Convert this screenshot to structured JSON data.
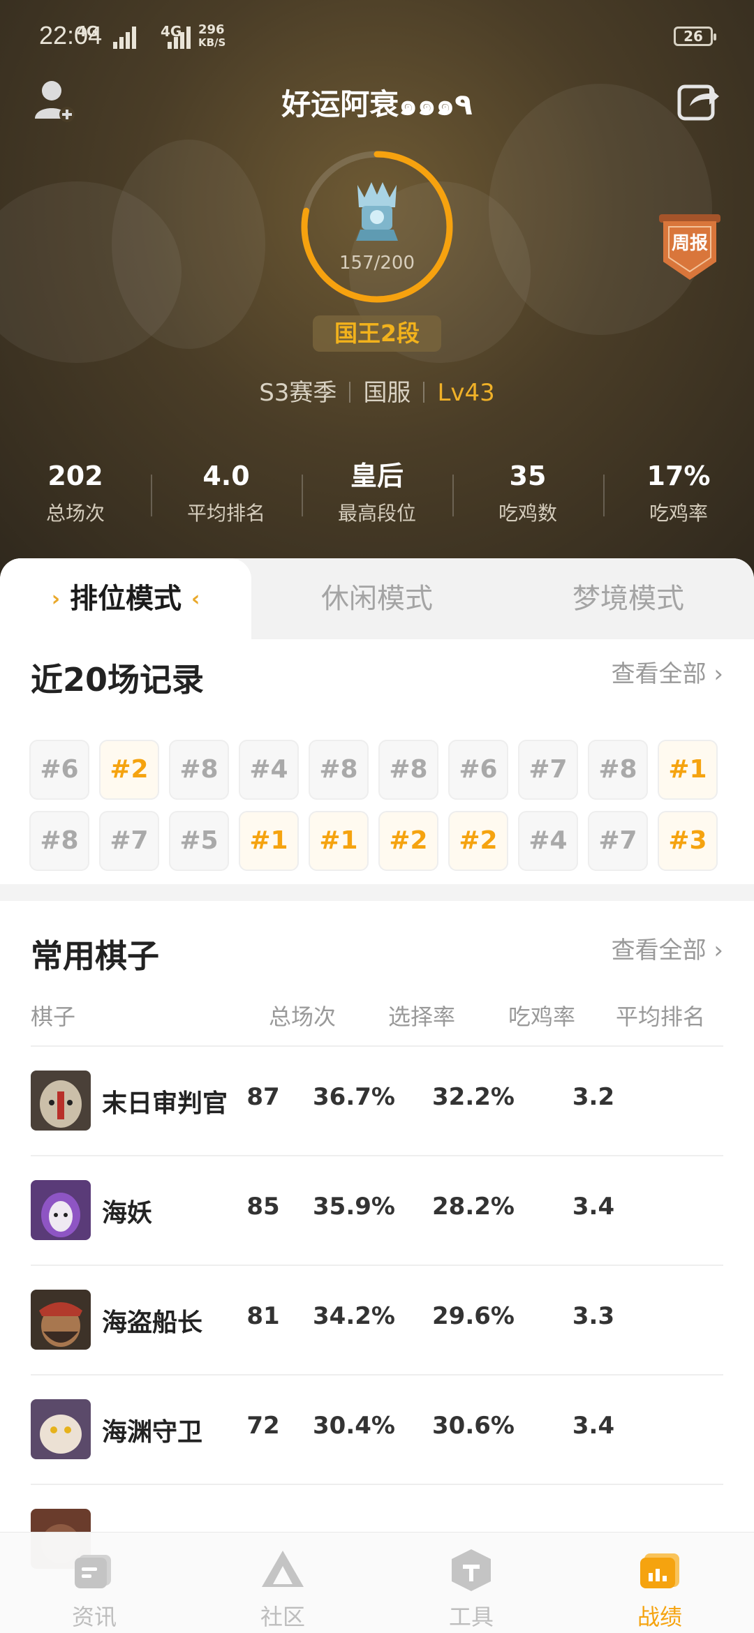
{
  "status_bar": {
    "time": "22:04",
    "network_1": "4G",
    "network_2": "4G",
    "speed_value": "296",
    "speed_unit": "KB/S",
    "battery": "26"
  },
  "profile": {
    "username": "好运阿衰๑๑๑٩",
    "rank_progress": "157/200",
    "rank_progress_fraction": 0.785,
    "rank_title": "国王2段",
    "season": "S3赛季",
    "server": "国服",
    "level": "Lv43",
    "weekly_report_label": "周报"
  },
  "stats": [
    {
      "value": "202",
      "label": "总场次"
    },
    {
      "value": "4.0",
      "label": "平均排名"
    },
    {
      "value": "皇后",
      "label": "最高段位"
    },
    {
      "value": "35",
      "label": "吃鸡数"
    },
    {
      "value": "17%",
      "label": "吃鸡率"
    }
  ],
  "tabs": [
    {
      "label": "排位模式",
      "active": true
    },
    {
      "label": "休闲模式",
      "active": false
    },
    {
      "label": "梦境模式",
      "active": false
    }
  ],
  "recent": {
    "title": "近20场记录",
    "view_all": "查看全部",
    "results": [
      "#6",
      "#2",
      "#8",
      "#4",
      "#8",
      "#8",
      "#6",
      "#7",
      "#8",
      "#1",
      "#8",
      "#7",
      "#5",
      "#1",
      "#1",
      "#2",
      "#2",
      "#4",
      "#7",
      "#3"
    ]
  },
  "pieces": {
    "title": "常用棋子",
    "view_all": "查看全部",
    "headers": [
      "棋子",
      "总场次",
      "选择率",
      "吃鸡率",
      "平均排名"
    ],
    "rows": [
      {
        "name": "末日审判官",
        "total": "87",
        "pick_rate": "36.7%",
        "win_rate": "32.2%",
        "avg_rank": "3.2"
      },
      {
        "name": "海妖",
        "total": "85",
        "pick_rate": "35.9%",
        "win_rate": "28.2%",
        "avg_rank": "3.4"
      },
      {
        "name": "海盗船长",
        "total": "81",
        "pick_rate": "34.2%",
        "win_rate": "29.6%",
        "avg_rank": "3.3"
      },
      {
        "name": "海渊守卫",
        "total": "72",
        "pick_rate": "30.4%",
        "win_rate": "30.6%",
        "avg_rank": "3.4"
      }
    ]
  },
  "bottom_nav": [
    {
      "label": "资讯",
      "icon": "news-icon",
      "active": false
    },
    {
      "label": "社区",
      "icon": "community-icon",
      "active": false
    },
    {
      "label": "工具",
      "icon": "tools-icon",
      "active": false
    },
    {
      "label": "战绩",
      "icon": "record-icon",
      "active": true
    }
  ],
  "colors": {
    "accent": "#f5a30f",
    "hero_bg": "#4a3d27"
  }
}
